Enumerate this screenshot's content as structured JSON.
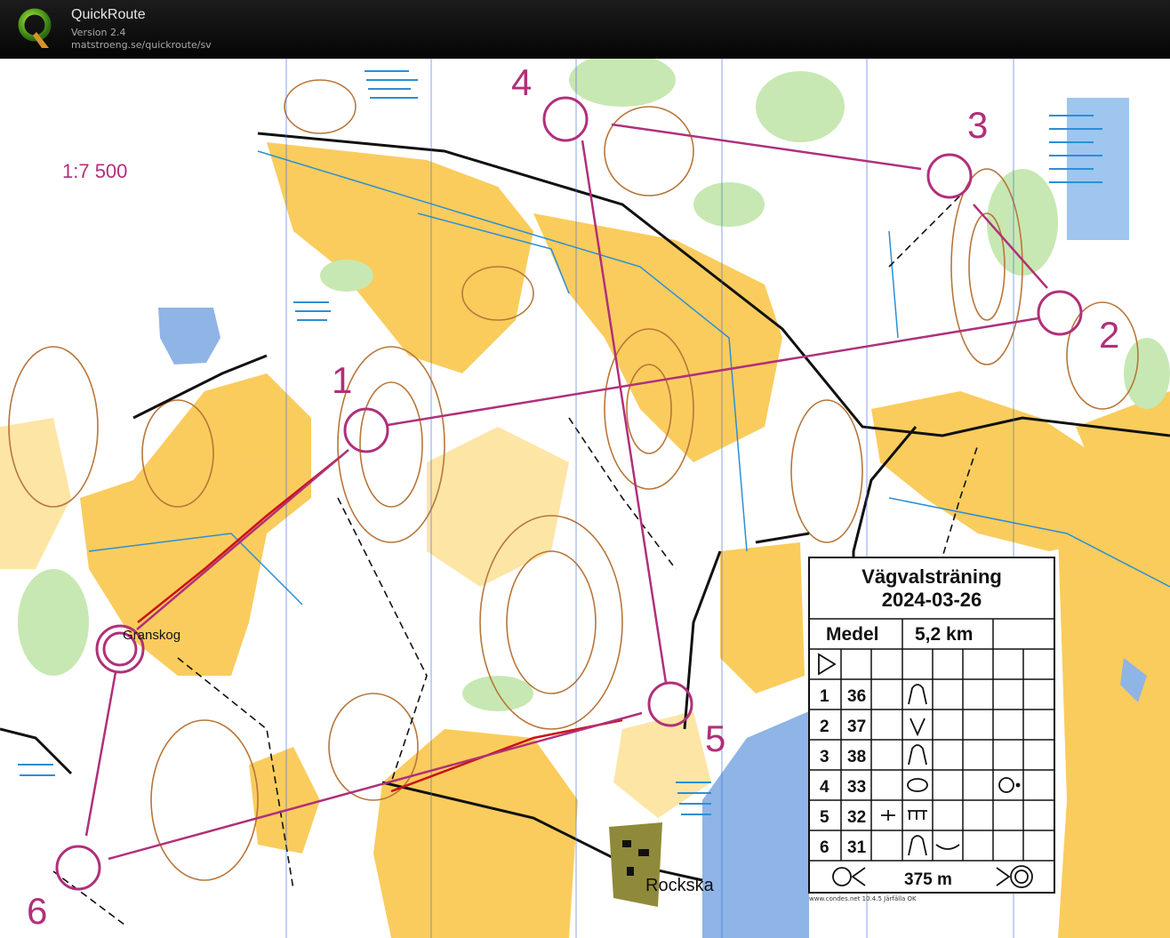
{
  "app": {
    "title": "QuickRoute",
    "version": "Version 2.4",
    "url": "matstroeng.se/quickroute/sv"
  },
  "map": {
    "scale": "1:7 500",
    "places": [
      "Granskog",
      "Rockska"
    ],
    "control_labels": [
      "1",
      "2",
      "3",
      "4",
      "5",
      "6"
    ],
    "colors": {
      "course": "#b0307a",
      "route": "#cc1212",
      "open_land": "#f9c74b",
      "rough_open": "#fde5a5",
      "forest": "#ffffff",
      "green": "#c7e8b2",
      "water": "#8fb4e6",
      "contour": "#b8763a",
      "road": "#111111",
      "marsh": "#2a8fd6"
    }
  },
  "card": {
    "title": "Vägvalsträning",
    "date": "2024-03-26",
    "class": "Medel",
    "distance": "5,2 km",
    "controls": [
      {
        "num": "1",
        "code": "36",
        "symbol": "knoll"
      },
      {
        "num": "2",
        "code": "37",
        "symbol": "reentrant"
      },
      {
        "num": "3",
        "code": "38",
        "symbol": "knoll"
      },
      {
        "num": "4",
        "code": "33",
        "symbol": "depression"
      },
      {
        "num": "5",
        "code": "32",
        "symbol": "crossing"
      },
      {
        "num": "6",
        "code": "31",
        "symbol": "knoll"
      }
    ],
    "finish_distance": "375 m"
  },
  "credit": "www.condes.net 10.4.5 Järfälla OK"
}
